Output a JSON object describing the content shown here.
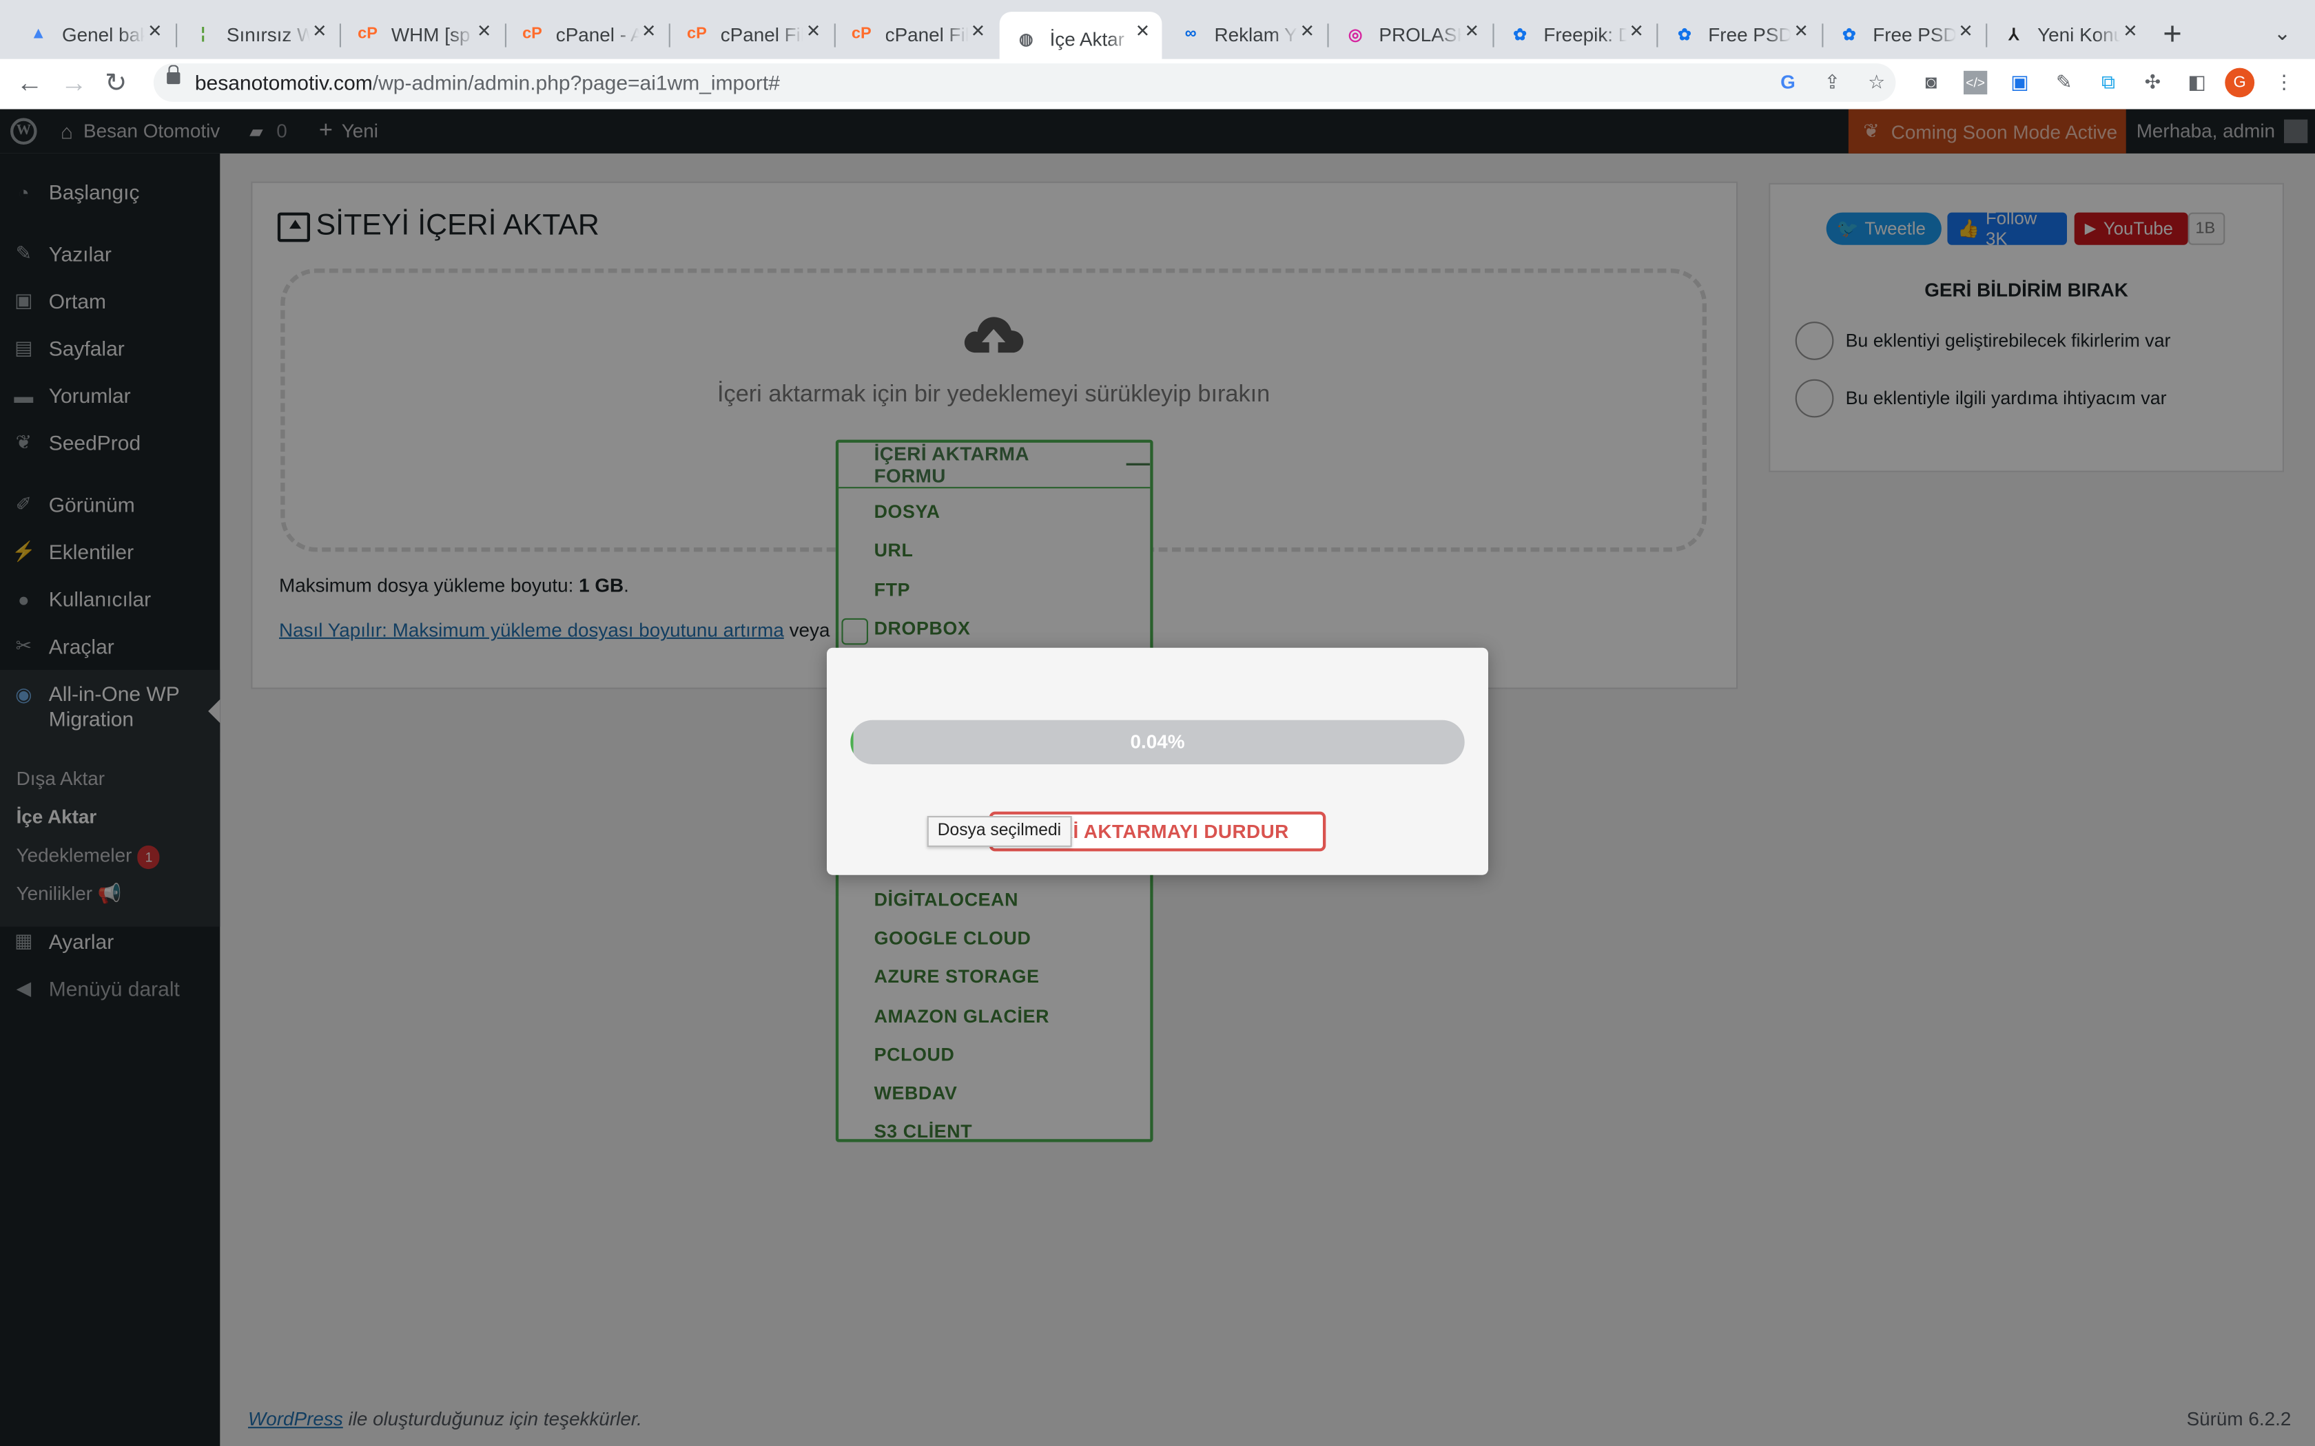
{
  "browser": {
    "tabs": [
      {
        "label": "Genel bakış",
        "icon": "google-ads-icon",
        "color": "#4285f4",
        "glyph": "▲"
      },
      {
        "label": "Sınırsız Web",
        "icon": "bamboo-icon",
        "color": "#5a9e3c",
        "glyph": "¦"
      },
      {
        "label": "WHM [sp",
        "icon": "cpanel-icon",
        "color": "#ff6c2c",
        "glyph": "cP"
      },
      {
        "label": "cPanel - A",
        "icon": "cpanel-icon",
        "color": "#ff6c2c",
        "glyph": "cP"
      },
      {
        "label": "cPanel Fil",
        "icon": "cpanel-icon",
        "color": "#ff6c2c",
        "glyph": "cP"
      },
      {
        "label": "cPanel Fil",
        "icon": "cpanel-icon",
        "color": "#ff6c2c",
        "glyph": "cP"
      },
      {
        "label": "İçe Aktar",
        "icon": "globe-icon",
        "color": "#5f6368",
        "glyph": "◍",
        "active": true
      },
      {
        "label": "Reklam Yö",
        "icon": "meta-icon",
        "color": "#0668e1",
        "glyph": "∞"
      },
      {
        "label": "PROLASH",
        "icon": "instagram-icon",
        "color": "#d6249f",
        "glyph": "◎"
      },
      {
        "label": "Freepik: D",
        "icon": "freepik-icon",
        "color": "#1273eb",
        "glyph": "✿"
      },
      {
        "label": "Free PSD",
        "icon": "freepik-icon",
        "color": "#1273eb",
        "glyph": "✿"
      },
      {
        "label": "Free PSD",
        "icon": "freepik-icon",
        "color": "#1273eb",
        "glyph": "✿"
      },
      {
        "label": "Yeni Konu",
        "icon": "forum-icon",
        "color": "#222222",
        "glyph": "⅄"
      }
    ],
    "url_host": "besanotomotiv.com",
    "url_path": "/wp-admin/admin.php?page=ai1wm_import#",
    "profile_initial": "G"
  },
  "adminbar": {
    "site_name": "Besan Otomotiv",
    "comments_count": "0",
    "new_label": "Yeni",
    "coming_soon": "Coming Soon Mode Active",
    "greeting": "Merhaba, admin"
  },
  "sidebar": {
    "items": [
      {
        "label": "Başlangıç",
        "icon": "dashboard-icon"
      },
      {
        "label": "Yazılar",
        "icon": "pin-icon"
      },
      {
        "label": "Ortam",
        "icon": "media-icon"
      },
      {
        "label": "Sayfalar",
        "icon": "pages-icon"
      },
      {
        "label": "Yorumlar",
        "icon": "comments-icon"
      },
      {
        "label": "SeedProd",
        "icon": "seedprod-icon"
      },
      {
        "label": "Görünüm",
        "icon": "appearance-icon"
      },
      {
        "label": "Eklentiler",
        "icon": "plugins-icon"
      },
      {
        "label": "Kullanıcılar",
        "icon": "users-icon"
      },
      {
        "label": "Araçlar",
        "icon": "tools-icon"
      },
      {
        "label": "All-in-One WP Migration",
        "icon": "migration-icon"
      },
      {
        "label": "Ayarlar",
        "icon": "settings-icon"
      },
      {
        "label": "Menüyü daralt",
        "icon": "collapse-icon"
      }
    ],
    "submenu": {
      "export": "Dışa Aktar",
      "import": "İçe Aktar",
      "backups": "Yedeklemeler",
      "backups_badge": "1",
      "whats_new": "Yenilikler 📢"
    }
  },
  "main": {
    "title": "SİTEYİ İÇERİ AKTAR",
    "drop_text": "İçeri aktarmak için bir yedeklemeyi sürükleyip bırakın",
    "import_form_label": "İÇERİ AKTARMA FORMU",
    "sources_top": [
      "DOSYA",
      "URL",
      "FTP",
      "DROPBOX"
    ],
    "sources_bottom": [
      "DİGİTALOCEAN",
      "GOOGLE CLOUD",
      "AZURE STORAGE",
      "AMAZON GLACİER",
      "PCLOUD",
      "WEBDAV",
      "S3 CLİENT"
    ],
    "max_size_label": "Maksimum dosya yükleme boyutu:",
    "max_size_value": "1 GB",
    "howto_link": "Nasıl Yapılır: Maksimum yükleme dosyası boyutunu artırma",
    "howto_or": "veya"
  },
  "side": {
    "tweet": "Tweetle",
    "follow": "Follow 3K",
    "youtube": "YouTube",
    "youtube_count": "1B",
    "feedback_title": "GERİ BİLDİRİM BIRAK",
    "options": [
      "Bu eklentiyi geliştirebilecek fikirlerim var",
      "Bu eklentiyle ilgili yardıma ihtiyacım var"
    ]
  },
  "modal": {
    "progress_text": "0.04%",
    "progress_value": 0.0004,
    "stop_label": "İÇERİ AKTARMAYI DURDUR",
    "tooltip": "Dosya seçilmedi"
  },
  "footer": {
    "wp_link": "WordPress",
    "thanks": " ile oluşturduğunuz için teşekkürler.",
    "version": "Sürüm 6.2.2"
  },
  "colors": {
    "admin_bar": "#1d2327",
    "accent_green": "#4caf50",
    "stop_red": "#d9534f",
    "coming_soon": "#c44b1a"
  }
}
